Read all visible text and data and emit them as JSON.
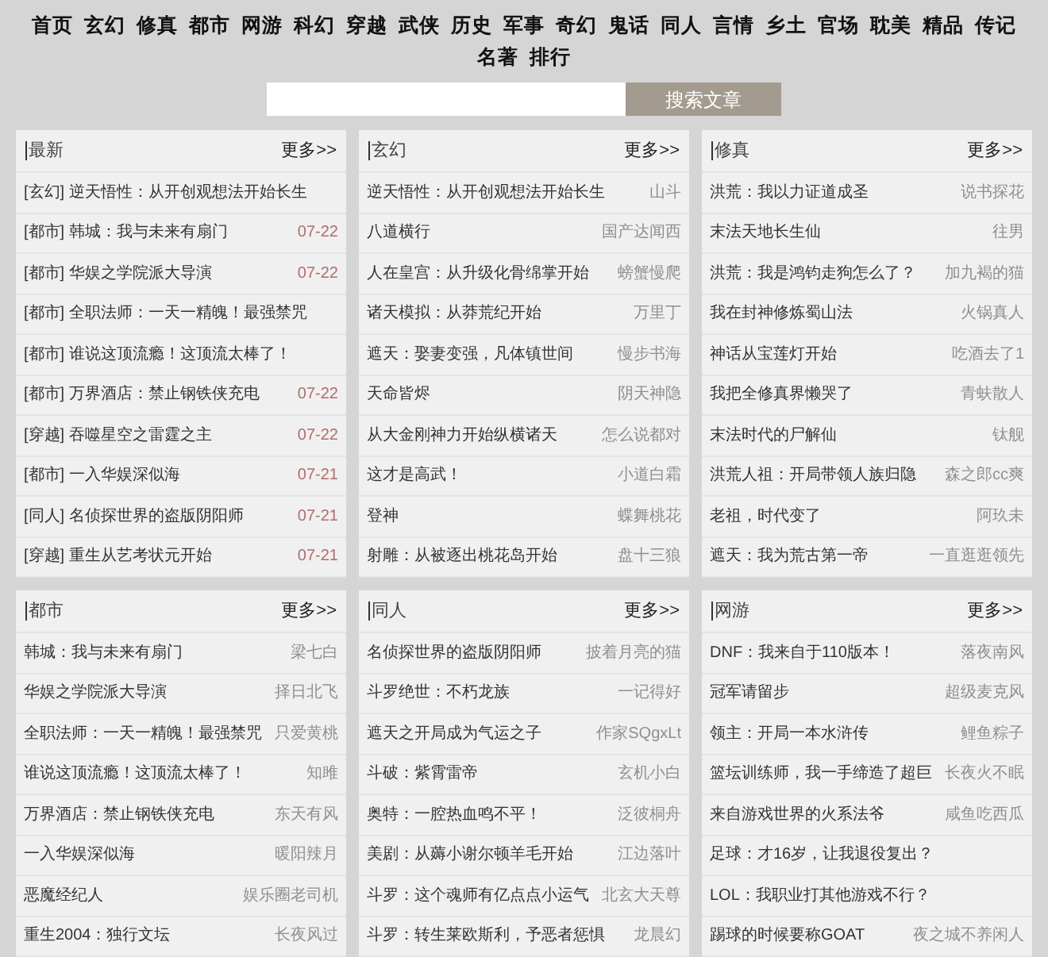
{
  "nav": [
    "首页",
    "玄幻",
    "修真",
    "都市",
    "网游",
    "科幻",
    "穿越",
    "武侠",
    "历史",
    "军事",
    "奇幻",
    "鬼话",
    "同人",
    "言情",
    "乡土",
    "官场",
    "耽美",
    "精品",
    "传记",
    "名著",
    "排行"
  ],
  "search": {
    "button": "搜索文章"
  },
  "panels": [
    {
      "title": "最新",
      "more": "更多>>",
      "rows": [
        {
          "title": "[玄幻] 逆天悟性：从开创观想法开始长生"
        },
        {
          "title": "[都市] 韩城：我与未来有扇门",
          "date": "07-22"
        },
        {
          "title": "[都市] 华娱之学院派大导演",
          "date": "07-22"
        },
        {
          "title": "[都市] 全职法师：一天一精魄！最强禁咒"
        },
        {
          "title": "[都市] 谁说这顶流瘾！这顶流太棒了！"
        },
        {
          "title": "[都市] 万界酒店：禁止钢铁侠充电",
          "date": "07-22"
        },
        {
          "title": "[穿越] 吞噬星空之雷霆之主",
          "date": "07-22"
        },
        {
          "title": "[都市] 一入华娱深似海",
          "date": "07-21"
        },
        {
          "title": "[同人] 名侦探世界的盗版阴阳师",
          "date": "07-21"
        },
        {
          "title": "[穿越] 重生从艺考状元开始",
          "date": "07-21"
        }
      ]
    },
    {
      "title": "玄幻",
      "more": "更多>>",
      "rows": [
        {
          "title": "逆天悟性：从开创观想法开始长生",
          "author": "山斗"
        },
        {
          "title": "八道横行",
          "author": "国产达闻西"
        },
        {
          "title": "人在皇宫：从升级化骨绵掌开始",
          "author": "螃蟹慢爬"
        },
        {
          "title": "诸天模拟：从莽荒纪开始",
          "author": "万里丁"
        },
        {
          "title": "遮天：娶妻变强，凡体镇世间",
          "author": "慢步书海"
        },
        {
          "title": "天命皆烬",
          "author": "阴天神隐"
        },
        {
          "title": "从大金刚神力开始纵横诸天",
          "author": "怎么说都对"
        },
        {
          "title": "这才是高武！",
          "author": "小道白霜"
        },
        {
          "title": "登神",
          "author": "蝶舞桃花"
        },
        {
          "title": "射雕：从被逐出桃花岛开始",
          "author": "盘十三狼"
        }
      ]
    },
    {
      "title": "修真",
      "more": "更多>>",
      "rows": [
        {
          "title": "洪荒：我以力证道成圣",
          "author": "说书探花"
        },
        {
          "title": "末法天地长生仙",
          "author": "往男"
        },
        {
          "title": "洪荒：我是鸿钧走狗怎么了？",
          "author": "加九褐的猫"
        },
        {
          "title": "我在封神修炼蜀山法",
          "author": "火锅真人"
        },
        {
          "title": "神话从宝莲灯开始",
          "author": "吃酒去了1"
        },
        {
          "title": "我把全修真界懒哭了",
          "author": "青蚨散人"
        },
        {
          "title": "末法时代的尸解仙",
          "author": "钛舰"
        },
        {
          "title": "洪荒人祖：开局带领人族归隐",
          "author": "森之郎cc爽"
        },
        {
          "title": "老祖，时代变了",
          "author": "阿玖未"
        },
        {
          "title": "遮天：我为荒古第一帝",
          "author": "一直逛逛领先"
        }
      ]
    },
    {
      "title": "都市",
      "more": "更多>>",
      "rows": [
        {
          "title": "韩城：我与未来有扇门",
          "author": "梁七白"
        },
        {
          "title": "华娱之学院派大导演",
          "author": "择日北飞"
        },
        {
          "title": "全职法师：一天一精魄！最强禁咒",
          "author": "只爱黄桃"
        },
        {
          "title": "谁说这顶流瘾！这顶流太棒了！",
          "author": "知雎"
        },
        {
          "title": "万界酒店：禁止钢铁侠充电",
          "author": "东天有风"
        },
        {
          "title": "一入华娱深似海",
          "author": "暖阳辣月"
        },
        {
          "title": "恶魔经纪人",
          "author": "娱乐圈老司机"
        },
        {
          "title": "重生2004：独行文坛",
          "author": "长夜风过"
        }
      ]
    },
    {
      "title": "同人",
      "more": "更多>>",
      "rows": [
        {
          "title": "名侦探世界的盗版阴阳师",
          "author": "披着月亮的猫"
        },
        {
          "title": "斗罗绝世：不朽龙族",
          "author": "一记得好"
        },
        {
          "title": "遮天之开局成为气运之子",
          "author": "作家SQgxLt"
        },
        {
          "title": "斗破：紫霄雷帝",
          "author": "玄机小白"
        },
        {
          "title": "奥特：一腔热血鸣不平！",
          "author": "泛彼桐舟"
        },
        {
          "title": "美剧：从薅小谢尔顿羊毛开始",
          "author": "江边落叶"
        },
        {
          "title": "斗罗：这个魂师有亿点点小运气",
          "author": "北玄大天尊"
        },
        {
          "title": "斗罗：转生莱欧斯利，予恶者惩惧",
          "author": "龙晨幻"
        }
      ]
    },
    {
      "title": "网游",
      "more": "更多>>",
      "rows": [
        {
          "title": "DNF：我来自于110版本！",
          "author": "落夜南风"
        },
        {
          "title": "冠军请留步",
          "author": "超级麦克风"
        },
        {
          "title": "领主：开局一本水浒传",
          "author": "鲤鱼粽子"
        },
        {
          "title": "篮坛训练师，我一手缔造了超巨",
          "author": "长夜火不眠"
        },
        {
          "title": "来自游戏世界的火系法爷",
          "author": "咸鱼吃西瓜"
        },
        {
          "title": "足球：才16岁，让我退役复出？"
        },
        {
          "title": "LOL：我职业打其他游戏不行？"
        },
        {
          "title": "踢球的时候要称GOAT",
          "author": "夜之城不养闲人"
        }
      ]
    }
  ]
}
